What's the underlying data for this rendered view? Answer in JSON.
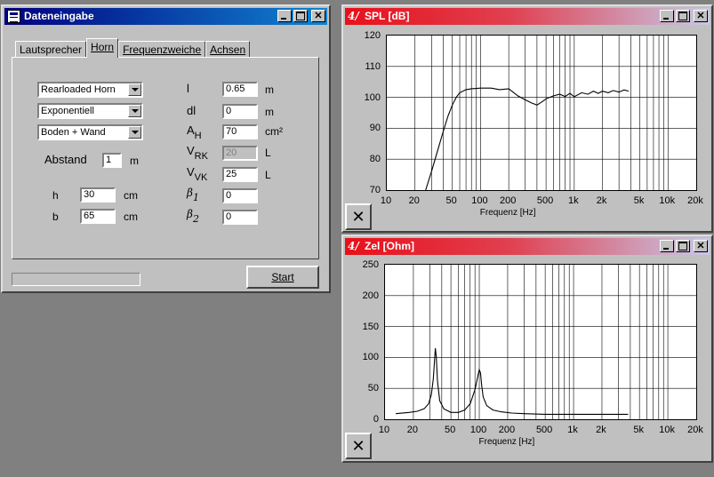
{
  "dialog": {
    "title": "Dateneingabe",
    "tabs": [
      "Lautsprecher",
      "Horn",
      "Frequenzweiche",
      "Achsen"
    ],
    "active_tab": "Horn",
    "horn_type": "Rearloaded Horn",
    "profile": "Exponentiell",
    "placement": "Boden + Wand",
    "abstand_label": "Abstand",
    "abstand_value": "1",
    "abstand_unit": "m",
    "h_label": "h",
    "h_value": "30",
    "h_unit": "cm",
    "b_label": "b",
    "b_value": "65",
    "b_unit": "cm",
    "params": [
      {
        "sym": "l",
        "sub": "",
        "value": "0.65",
        "unit": "m",
        "disabled": false
      },
      {
        "sym": "dl",
        "sub": "",
        "value": "0",
        "unit": "m",
        "disabled": false
      },
      {
        "sym": "A",
        "sub": "H",
        "value": "70",
        "unit": "cm²",
        "disabled": false
      },
      {
        "sym": "V",
        "sub": "RK",
        "value": "20",
        "unit": "L",
        "disabled": true
      },
      {
        "sym": "V",
        "sub": "VK",
        "value": "25",
        "unit": "L",
        "disabled": false
      },
      {
        "sym": "β",
        "sub": "1",
        "value": "0",
        "unit": "",
        "disabled": false
      },
      {
        "sym": "β",
        "sub": "2",
        "value": "0",
        "unit": "",
        "disabled": false
      }
    ],
    "start_label": "Start"
  },
  "spl_window": {
    "title": "SPL [dB]",
    "close_glyph": "✕"
  },
  "zel_window": {
    "title": "Zel [Ohm]",
    "close_glyph": "✕"
  },
  "chart_data": [
    {
      "type": "line",
      "title": "SPL [dB]",
      "xlabel": "Frequenz [Hz]",
      "ylabel": "",
      "xscale": "log",
      "xlim": [
        10,
        20000
      ],
      "ylim": [
        70,
        120
      ],
      "yticks": [
        "120",
        "110",
        "100",
        "90",
        "80",
        "70"
      ],
      "xticks": [
        "10",
        "20",
        "50",
        "100",
        "200",
        "500",
        "1k",
        "2k",
        "5k",
        "10k",
        "20k"
      ],
      "grid": true,
      "series": [
        {
          "x": [
            26,
            30,
            35,
            40,
            45,
            50,
            55,
            60,
            70,
            80,
            100,
            130,
            160,
            200,
            250,
            300,
            350,
            400,
            450,
            500,
            600,
            700,
            800,
            900,
            1000,
            1200,
            1400,
            1600,
            1800,
            2000,
            2300,
            2600,
            3000,
            3400,
            3800
          ],
          "y": [
            70,
            76,
            83,
            89,
            94,
            97.5,
            100,
            101.5,
            102.5,
            102.8,
            103,
            103,
            102.5,
            102.8,
            100.5,
            99.2,
            98.2,
            97.5,
            98.5,
            99.5,
            100.5,
            101,
            100.3,
            101.3,
            100.2,
            101.5,
            101,
            102,
            101.3,
            102,
            101.5,
            102.2,
            101.7,
            102.4,
            102
          ]
        }
      ]
    },
    {
      "type": "line",
      "title": "Zel [Ohm]",
      "xlabel": "Frequenz [Hz]",
      "ylabel": "",
      "xscale": "log",
      "xlim": [
        10,
        20000
      ],
      "ylim": [
        0,
        250
      ],
      "yticks": [
        "250",
        "200",
        "150",
        "100",
        "50",
        "0"
      ],
      "xticks": [
        "10",
        "20",
        "50",
        "100",
        "200",
        "500",
        "1k",
        "2k",
        "5k",
        "10k",
        "20k"
      ],
      "grid": true,
      "series": [
        {
          "x": [
            13,
            18,
            22,
            26,
            29,
            31,
            32.5,
            33.5,
            34.2,
            35,
            36,
            38,
            42,
            50,
            60,
            70,
            80,
            90,
            95,
            100,
            103,
            106,
            110,
            120,
            140,
            170,
            220,
            300,
            500,
            1000,
            2000,
            3800
          ],
          "y": [
            9,
            11,
            13,
            17,
            25,
            40,
            65,
            95,
            115,
            100,
            62,
            30,
            17,
            11,
            11,
            15,
            25,
            48,
            65,
            80,
            75,
            55,
            36,
            22,
            15,
            12,
            10,
            9,
            8,
            8,
            8,
            8
          ]
        }
      ]
    }
  ]
}
